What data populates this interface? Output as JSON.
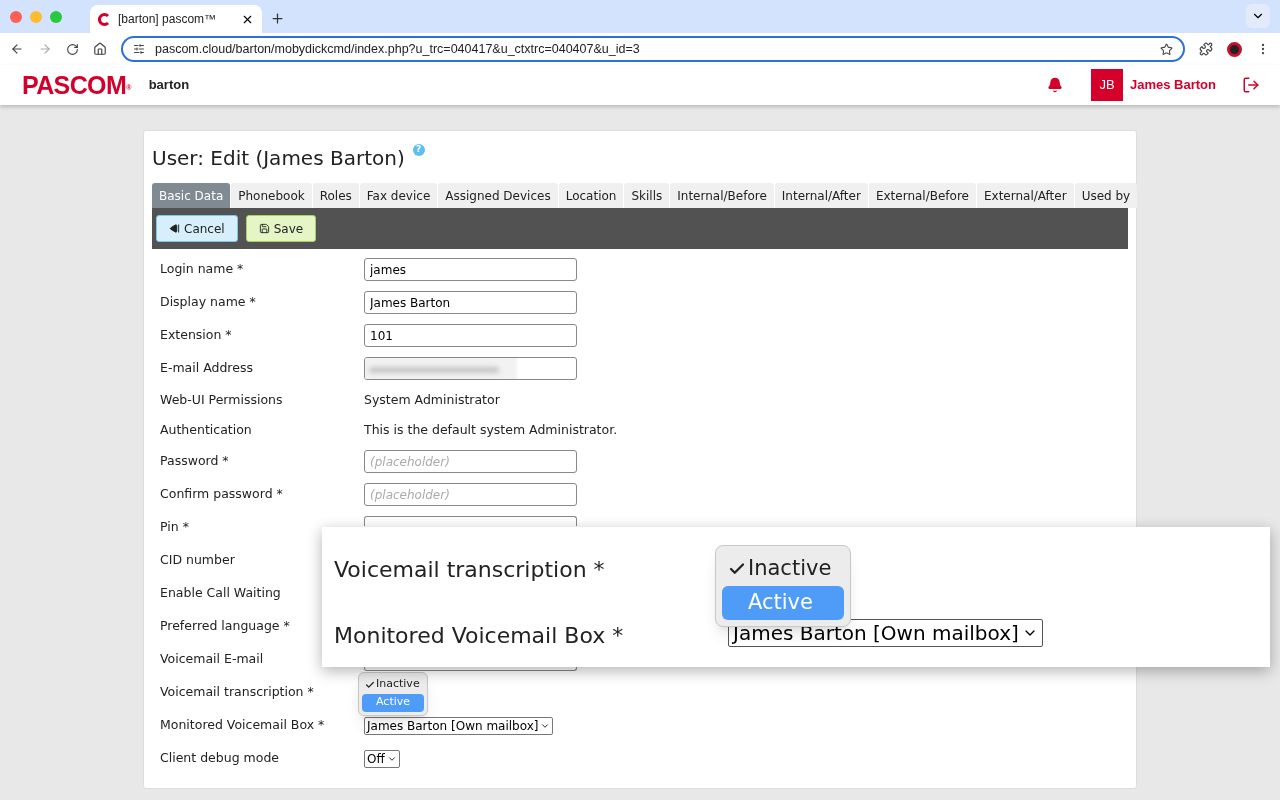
{
  "browser": {
    "tab_title": "[barton] pascom™",
    "url": "pascom.cloud/barton/mobydickcmd/index.php?u_trc=040417&u_ctxtrc=040407&u_id=3"
  },
  "header": {
    "logo": "PASCOM",
    "logo_mark": "®",
    "tenant": "barton",
    "avatar": "JB",
    "user": "James Barton"
  },
  "page": {
    "title": "User: Edit (James Barton)",
    "help": "?"
  },
  "tabs": [
    {
      "label": "Basic Data",
      "selected": true
    },
    {
      "label": "Phonebook",
      "selected": false
    },
    {
      "label": "Roles",
      "selected": false
    },
    {
      "label": "Fax device",
      "selected": false
    },
    {
      "label": "Assigned Devices",
      "selected": false
    },
    {
      "label": "Location",
      "selected": false
    },
    {
      "label": "Skills",
      "selected": false
    },
    {
      "label": "Internal/Before",
      "selected": false
    },
    {
      "label": "Internal/After",
      "selected": false
    },
    {
      "label": "External/Before",
      "selected": false
    },
    {
      "label": "External/After",
      "selected": false
    },
    {
      "label": "Used by",
      "selected": false
    }
  ],
  "toolbar": [
    {
      "label": "Cancel",
      "kind": "cancel"
    },
    {
      "label": "Save",
      "kind": "save"
    }
  ],
  "rows": [
    {
      "label": "Login name *",
      "kind": "input",
      "value": "james"
    },
    {
      "label": "Display name *",
      "kind": "input",
      "value": "James Barton"
    },
    {
      "label": "Extension *",
      "kind": "input",
      "value": "101"
    },
    {
      "label": "E-mail Address",
      "kind": "blurred"
    },
    {
      "label": "Web-UI Permissions",
      "kind": "text",
      "value": "System Administrator"
    },
    {
      "label": "Authentication",
      "kind": "text",
      "value": "This is the default system Administrator."
    },
    {
      "label": "Password *",
      "kind": "input",
      "placeholder": "(placeholder)"
    },
    {
      "label": "Confirm password *",
      "kind": "input",
      "placeholder": "(placeholder)"
    },
    {
      "label": "Pin *",
      "kind": "covered_input"
    },
    {
      "label": "CID number",
      "kind": "none"
    },
    {
      "label": "Enable Call Waiting",
      "kind": "none"
    },
    {
      "label": "Preferred language *",
      "kind": "none"
    },
    {
      "label": "Voicemail E-mail",
      "kind": "blurred_covered"
    },
    {
      "label": "Voicemail transcription *",
      "kind": "open_select"
    },
    {
      "label": "Monitored Voicemail Box *",
      "kind": "select",
      "value": "James Barton [Own mailbox]"
    },
    {
      "label": "Client debug mode",
      "kind": "select",
      "value": "Off"
    }
  ],
  "dropdown": [
    {
      "label": "Inactive",
      "checked": true,
      "selected": false
    },
    {
      "label": "Active",
      "checked": false,
      "selected": true
    }
  ],
  "callout": {
    "labels": [
      "Voicemail transcription *",
      "Monitored Voicemail Box *"
    ],
    "dropdown": [
      {
        "label": "Inactive",
        "checked": true,
        "selected": false
      },
      {
        "label": "Active",
        "checked": false,
        "selected": true
      }
    ],
    "select_value": "James Barton [Own mailbox]"
  }
}
